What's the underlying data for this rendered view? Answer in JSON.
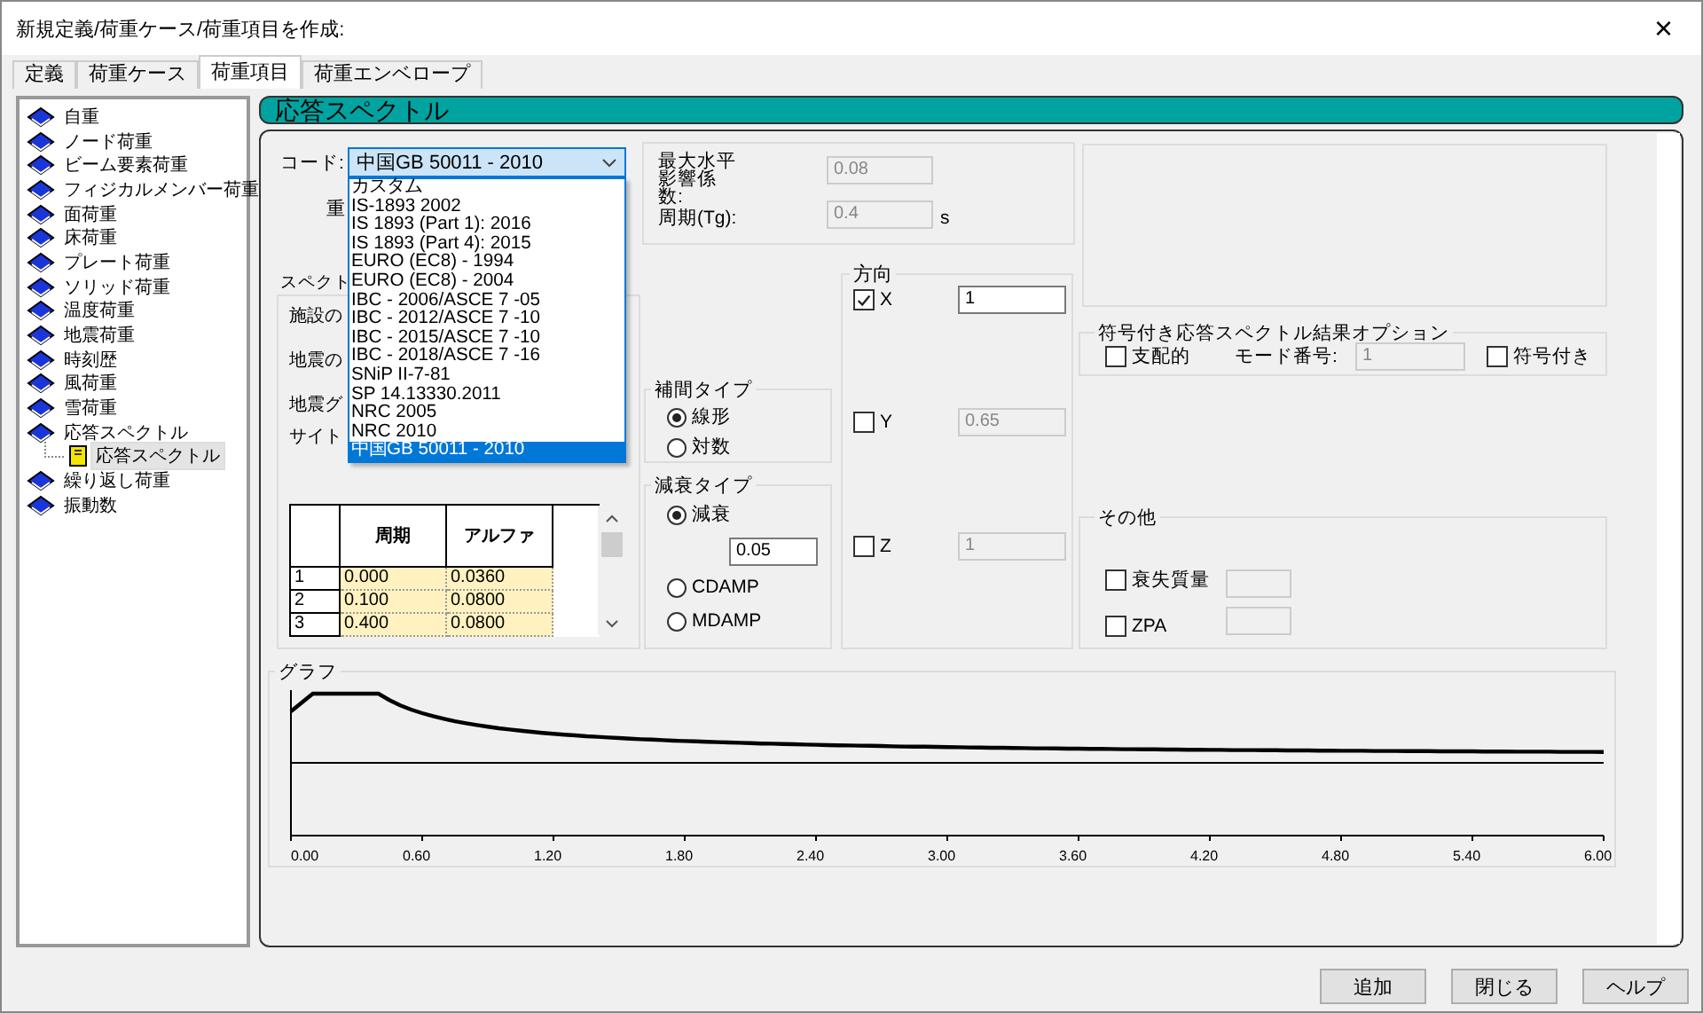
{
  "window": {
    "title": "新規定義/荷重ケース/荷重項目を作成:",
    "close": "×"
  },
  "tabs": [
    {
      "label": "定義",
      "selected": false
    },
    {
      "label": "荷重ケース",
      "selected": false
    },
    {
      "label": "荷重項目",
      "selected": true
    },
    {
      "label": "荷重エンベロープ",
      "selected": false
    }
  ],
  "tree": [
    {
      "label": "自重",
      "selected": false
    },
    {
      "label": "ノード荷重",
      "selected": false
    },
    {
      "label": "ビーム要素荷重",
      "selected": false
    },
    {
      "label": "フィジカルメンバー荷重",
      "selected": false
    },
    {
      "label": "面荷重",
      "selected": false
    },
    {
      "label": "床荷重",
      "selected": false
    },
    {
      "label": "プレート荷重",
      "selected": false
    },
    {
      "label": "ソリッド荷重",
      "selected": false
    },
    {
      "label": "温度荷重",
      "selected": false
    },
    {
      "label": "地震荷重",
      "selected": false
    },
    {
      "label": "時刻歴",
      "selected": false
    },
    {
      "label": "風荷重",
      "selected": false
    },
    {
      "label": "雪荷重",
      "selected": false
    },
    {
      "label": "応答スペクトル",
      "selected": false,
      "children": [
        {
          "label": "応答スペクトル",
          "selected": true
        }
      ]
    },
    {
      "label": "繰り返し荷重",
      "selected": false
    },
    {
      "label": "振動数",
      "selected": false
    }
  ],
  "header": "応答スペクトル",
  "code": {
    "label": "コード:",
    "value": "中国GB 50011 - 2010",
    "expanded": true,
    "options": [
      {
        "label": "カスタム",
        "selected": false
      },
      {
        "label": "IS-1893 2002",
        "selected": false
      },
      {
        "label": "IS 1893 (Part 1): 2016",
        "selected": false
      },
      {
        "label": "IS 1893 (Part 4): 2015",
        "selected": false
      },
      {
        "label": "EURO (EC8) - 1994",
        "selected": false
      },
      {
        "label": "EURO (EC8) - 2004",
        "selected": false
      },
      {
        "label": "IBC - 2006/ASCE 7 -05",
        "selected": false
      },
      {
        "label": "IBC - 2012/ASCE 7 -10",
        "selected": false
      },
      {
        "label": "IBC - 2015/ASCE 7 -10",
        "selected": false
      },
      {
        "label": "IBC - 2018/ASCE 7 -16",
        "selected": false
      },
      {
        "label": "SNiP II-7-81",
        "selected": false
      },
      {
        "label": "SP 14.13330.2011",
        "selected": false
      },
      {
        "label": "NRC 2005",
        "selected": false
      },
      {
        "label": "NRC 2010",
        "selected": false
      },
      {
        "label": "中国GB 50011 - 2010",
        "selected": true
      }
    ]
  },
  "hidden_labels": [
    "重",
    "スペクト",
    "施設の",
    "地震の",
    "地震グ",
    "サイト"
  ],
  "table": {
    "columns": [
      "周期",
      "アルファ"
    ],
    "rows": [
      {
        "index": "1",
        "cells": [
          "0.000",
          "0.0360"
        ]
      },
      {
        "index": "2",
        "cells": [
          "0.100",
          "0.0800"
        ]
      },
      {
        "index": "3",
        "cells": [
          "0.400",
          "0.0800"
        ]
      }
    ]
  },
  "factors": [
    {
      "label": "最大水平影響係数:",
      "value": "0.08"
    },
    {
      "label": "周期(Tg):",
      "value": "0.4",
      "unit": "s"
    }
  ],
  "interpolation": {
    "title": "補間タイプ",
    "options": [
      {
        "label": "線形",
        "selected": true
      },
      {
        "label": "対数",
        "selected": false
      }
    ]
  },
  "damping": {
    "title": "減衰タイプ",
    "options": [
      {
        "label": "減衰",
        "selected": true,
        "value": "0.05"
      },
      {
        "label": "CDAMP",
        "selected": false
      },
      {
        "label": "MDAMP",
        "selected": false
      }
    ]
  },
  "direction": {
    "title": "方向",
    "items": [
      {
        "label": "X",
        "checked": true,
        "value": "1",
        "disabled": false
      },
      {
        "label": "Y",
        "checked": false,
        "value": "0.65",
        "disabled": true
      },
      {
        "label": "Z",
        "checked": false,
        "value": "1",
        "disabled": true
      }
    ]
  },
  "signed": {
    "title": "符号付き応答スペクトル結果オプション",
    "dominant": {
      "label": "支配的",
      "checked": false
    },
    "mode_label": "モード番号:",
    "mode_value": "1",
    "signed": {
      "label": "符号付き",
      "checked": false
    }
  },
  "other": {
    "title": "その他",
    "items": [
      {
        "label": "衰失質量",
        "checked": false
      },
      {
        "label": "ZPA",
        "checked": false
      }
    ]
  },
  "graph": {
    "title": "グラフ",
    "x_labels": [
      "0.00",
      "0.60",
      "1.20",
      "1.80",
      "2.40",
      "3.00",
      "3.60",
      "4.20",
      "4.80",
      "5.40",
      "6.00"
    ]
  },
  "buttons": [
    "追加",
    "閉じる",
    "ヘルプ"
  ]
}
